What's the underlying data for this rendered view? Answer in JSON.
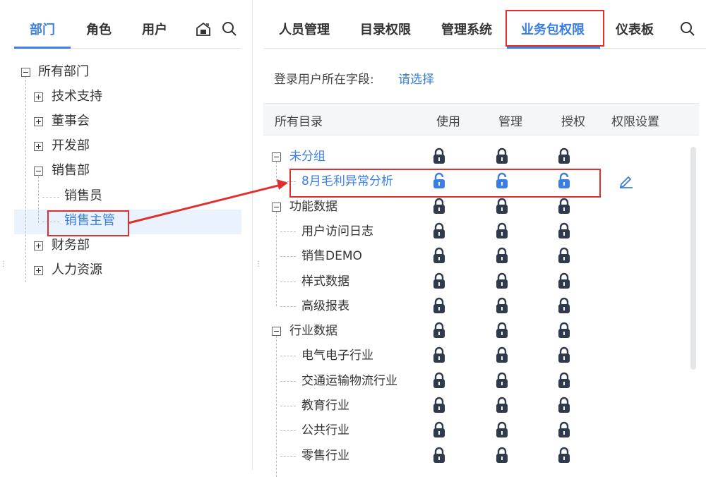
{
  "left": {
    "tabs": [
      {
        "label": "部门",
        "active": true
      },
      {
        "label": "角色",
        "active": false
      },
      {
        "label": "用户",
        "active": false
      }
    ],
    "tree": {
      "root": "所有部门",
      "items": [
        {
          "label": "技术支持",
          "expand": "plus"
        },
        {
          "label": "董事会",
          "expand": "plus"
        },
        {
          "label": "开发部",
          "expand": "plus"
        },
        {
          "label": "销售部",
          "expand": "minus"
        },
        {
          "label": "销售员",
          "expand": "none"
        },
        {
          "label": "销售主管",
          "expand": "none",
          "selected": true
        },
        {
          "label": "财务部",
          "expand": "plus"
        },
        {
          "label": "人力资源",
          "expand": "plus"
        }
      ]
    }
  },
  "right": {
    "tabs": [
      {
        "label": "人员管理",
        "active": false
      },
      {
        "label": "目录权限",
        "active": false
      },
      {
        "label": "管理系统",
        "active": false
      },
      {
        "label": "业务包权限",
        "active": true
      },
      {
        "label": "仪表板",
        "active": false
      }
    ],
    "field_label": "登录用户所在字段:",
    "field_value": "请选择",
    "columns": [
      "所有目录",
      "使用",
      "管理",
      "授权",
      "权限设置"
    ],
    "rows": [
      {
        "label": "未分组",
        "level": 0,
        "group": true,
        "color": "blue",
        "locks": [
          "locked",
          "locked",
          "locked"
        ]
      },
      {
        "label": "8月毛利异常分析",
        "level": 1,
        "color": "blue",
        "locks": [
          "unlocked",
          "unlocked",
          "unlocked"
        ],
        "edit": true
      },
      {
        "label": "功能数据",
        "level": 0,
        "group": true,
        "locks": [
          "locked",
          "locked",
          "locked"
        ]
      },
      {
        "label": "用户访问日志",
        "level": 1,
        "locks": [
          "locked",
          "locked",
          "locked"
        ]
      },
      {
        "label": "销售DEMO",
        "level": 1,
        "locks": [
          "locked",
          "locked",
          "locked"
        ]
      },
      {
        "label": "样式数据",
        "level": 1,
        "locks": [
          "locked",
          "locked",
          "locked"
        ]
      },
      {
        "label": "高级报表",
        "level": 1,
        "locks": [
          "locked",
          "locked",
          "locked"
        ]
      },
      {
        "label": "行业数据",
        "level": 0,
        "group": true,
        "locks": [
          "locked",
          "locked",
          "locked"
        ]
      },
      {
        "label": "电气电子行业",
        "level": 1,
        "locks": [
          "locked",
          "locked",
          "locked"
        ]
      },
      {
        "label": "交通运输物流行业",
        "level": 1,
        "locks": [
          "locked",
          "locked",
          "locked"
        ]
      },
      {
        "label": "教育行业",
        "level": 1,
        "locks": [
          "locked",
          "locked",
          "locked"
        ]
      },
      {
        "label": "公共行业",
        "level": 1,
        "locks": [
          "locked",
          "locked",
          "locked"
        ]
      },
      {
        "label": "零售行业",
        "level": 1,
        "locks": [
          "locked",
          "locked",
          "locked"
        ]
      }
    ]
  },
  "colors": {
    "accent": "#3a7ee6",
    "highlight": "#e0302d",
    "lock": "#2f3a4d"
  },
  "icons": [
    "cloud-house-icon",
    "search-icon",
    "edit-pencil-icon",
    "lock-icon",
    "unlock-icon"
  ]
}
